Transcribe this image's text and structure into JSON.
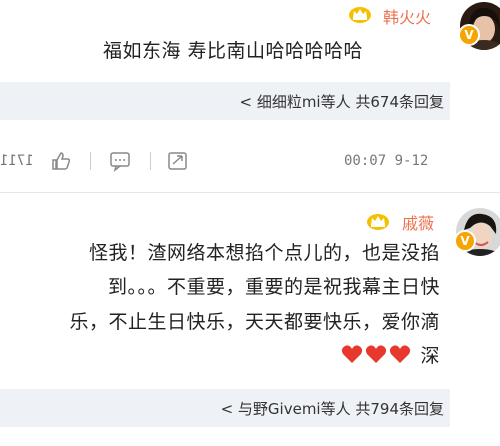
{
  "comments": [
    {
      "user_name": "韩火火",
      "text_lines": [
        "福如东海 寿比南山哈哈哈哈哈"
      ],
      "reply_summary": "细细粒mi等人 共674条回复 >",
      "time": "9-12 00:07",
      "like_count": "1711"
    },
    {
      "user_name": "戚薇",
      "text_lines": [
        "怪我！渣网络本想掐个点儿的，也是没掐",
        "到。。。不重要，重要的是祝我幕主日快",
        "乐，不止生日快乐，天天都要快乐，爱你滴",
        "深"
      ],
      "reply_summary": "与野Givemi等人 共794条回复 >"
    }
  ],
  "colors": {
    "name": "#eb7350",
    "reply_bg": "#eef2f6",
    "badge": "#f5a400",
    "heart": "#e8372c"
  },
  "icons": {
    "crown": "crown-icon",
    "verified": "verified-v-icon",
    "share": "share-icon",
    "comment": "comment-icon",
    "like": "thumbs-up-icon",
    "heart": "heart-icon"
  }
}
